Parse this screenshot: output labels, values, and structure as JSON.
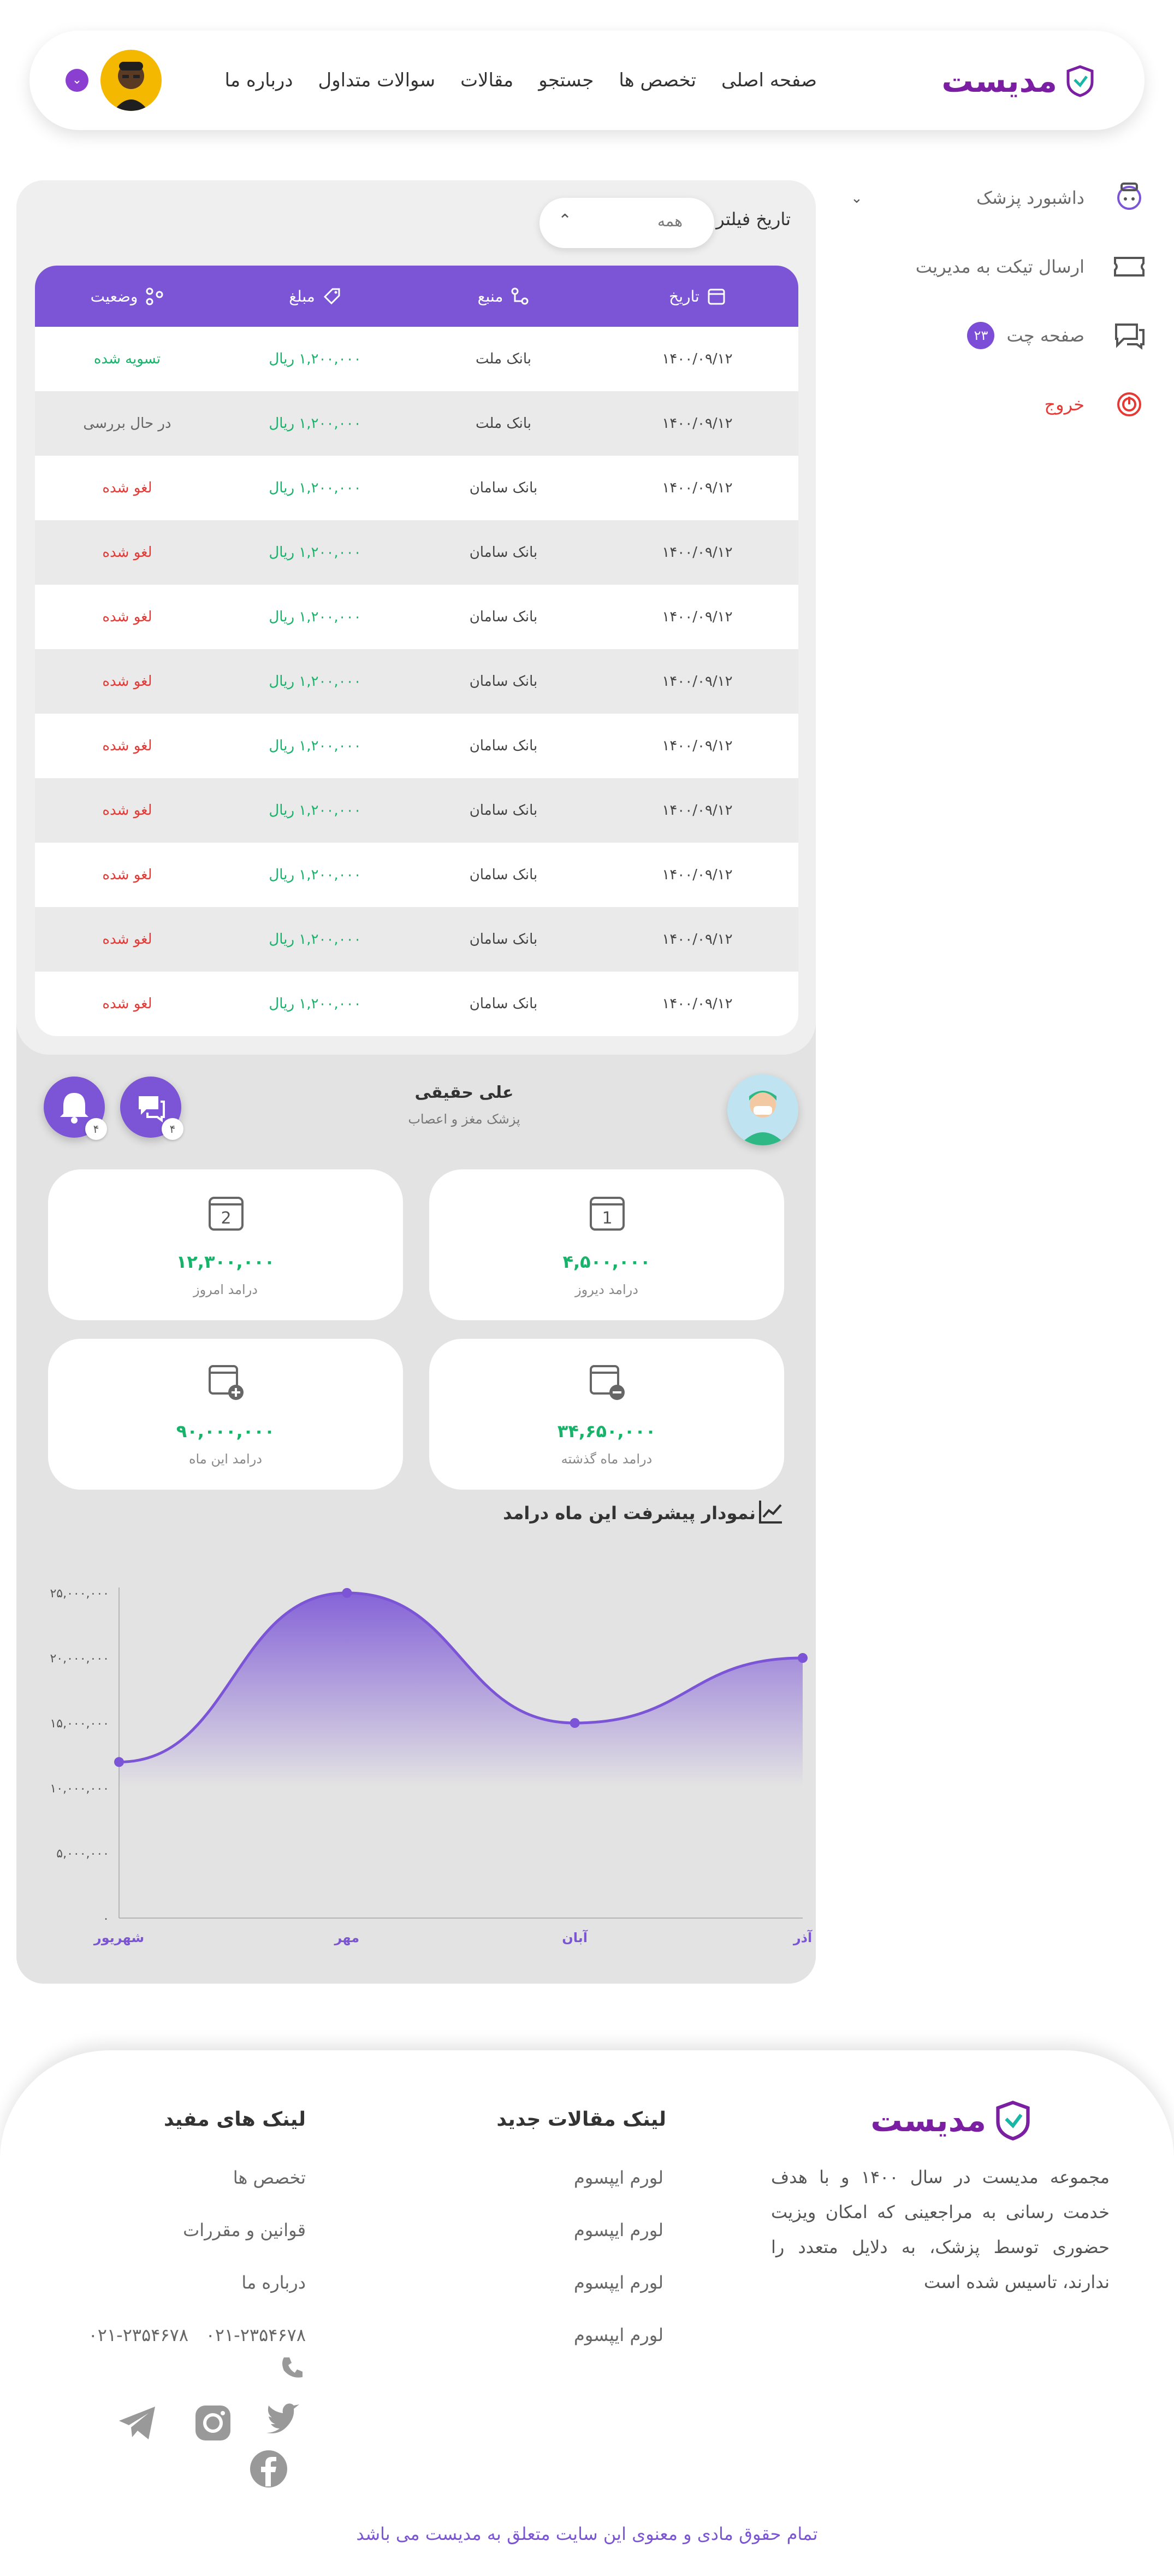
{
  "header": {
    "brand": "مدیست",
    "nav": [
      "صفحه اصلی",
      "تخصص ها",
      "جستجو",
      "مقالات",
      "سوالات متداول",
      "درباره ما"
    ]
  },
  "sidebar": {
    "items": [
      {
        "label": "داشبورد پزشک",
        "icon": "doctor-icon"
      },
      {
        "label": "ارسال تیکت به مدیریت",
        "icon": "ticket-icon"
      },
      {
        "label": "صفحه چت",
        "icon": "chat-icon",
        "badge": "۲۳"
      },
      {
        "label": "خروج",
        "icon": "power-icon"
      }
    ]
  },
  "filter": {
    "label": "تاریخ فیلتر",
    "value": "همه"
  },
  "table": {
    "headers": [
      "تاریخ",
      "منبع",
      "مبلغ",
      "وضعیت"
    ],
    "rows": [
      {
        "date": "۱۴۰۰/۰۹/۱۲",
        "source": "بانک ملت",
        "amount": "۱,۲۰۰,۰۰۰ ریال",
        "status": "تسویه شده",
        "status_type": "green"
      },
      {
        "date": "۱۴۰۰/۰۹/۱۲",
        "source": "بانک ملت",
        "amount": "۱,۲۰۰,۰۰۰ ریال",
        "status": "در حال بررسی",
        "status_type": "gray"
      },
      {
        "date": "۱۴۰۰/۰۹/۱۲",
        "source": "بانک سامان",
        "amount": "۱,۲۰۰,۰۰۰ ریال",
        "status": "لغو شده",
        "status_type": "red"
      },
      {
        "date": "۱۴۰۰/۰۹/۱۲",
        "source": "بانک سامان",
        "amount": "۱,۲۰۰,۰۰۰ ریال",
        "status": "لغو شده",
        "status_type": "red"
      },
      {
        "date": "۱۴۰۰/۰۹/۱۲",
        "source": "بانک سامان",
        "amount": "۱,۲۰۰,۰۰۰ ریال",
        "status": "لغو شده",
        "status_type": "red"
      },
      {
        "date": "۱۴۰۰/۰۹/۱۲",
        "source": "بانک سامان",
        "amount": "۱,۲۰۰,۰۰۰ ریال",
        "status": "لغو شده",
        "status_type": "red"
      },
      {
        "date": "۱۴۰۰/۰۹/۱۲",
        "source": "بانک سامان",
        "amount": "۱,۲۰۰,۰۰۰ ریال",
        "status": "لغو شده",
        "status_type": "red"
      },
      {
        "date": "۱۴۰۰/۰۹/۱۲",
        "source": "بانک سامان",
        "amount": "۱,۲۰۰,۰۰۰ ریال",
        "status": "لغو شده",
        "status_type": "red"
      },
      {
        "date": "۱۴۰۰/۰۹/۱۲",
        "source": "بانک سامان",
        "amount": "۱,۲۰۰,۰۰۰ ریال",
        "status": "لغو شده",
        "status_type": "red"
      },
      {
        "date": "۱۴۰۰/۰۹/۱۲",
        "source": "بانک سامان",
        "amount": "۱,۲۰۰,۰۰۰ ریال",
        "status": "لغو شده",
        "status_type": "red"
      },
      {
        "date": "۱۴۰۰/۰۹/۱۲",
        "source": "بانک سامان",
        "amount": "۱,۲۰۰,۰۰۰ ریال",
        "status": "لغو شده",
        "status_type": "red"
      }
    ]
  },
  "doctor": {
    "name": "علی حقیقی",
    "specialty": "پزشک مغز و اعصاب",
    "chat_badge": "۴",
    "bell_badge": "۴"
  },
  "stats": [
    {
      "value": "۴,۵۰۰,۰۰۰",
      "label": "درامد دیروز"
    },
    {
      "value": "۱۲,۳۰۰,۰۰۰",
      "label": "درامد امروز"
    },
    {
      "value": "۳۴,۶۵۰,۰۰۰",
      "label": "درامد ماه گذشته"
    },
    {
      "value": "۹۰,۰۰۰,۰۰۰",
      "label": "درامد این ماه"
    }
  ],
  "chart_title": "نمودار پیشرفت این ماه درامد",
  "chart_data": {
    "type": "area",
    "categories": [
      "شهریور",
      "مهر",
      "آبان",
      "آذر"
    ],
    "values": [
      12000000,
      25000000,
      15000000,
      20000000
    ],
    "ylim": [
      0,
      25000000
    ],
    "yticks": [
      "۰",
      "۵,۰۰۰,۰۰۰",
      "۱۰,۰۰۰,۰۰۰",
      "۱۵,۰۰۰,۰۰۰",
      "۲۰,۰۰۰,۰۰۰",
      "۲۵,۰۰۰,۰۰۰"
    ],
    "title": "نمودار پیشرفت این ماه درامد",
    "color": "#7b55d6"
  },
  "footer": {
    "brand": "مدیست",
    "about": "مجموعه مدیست در سال ۱۴۰۰ و با هدف خدمت رسانی به مراجعینی که امکان ویزیت حضوری توسط پزشک، به دلایل متعدد را ندارند، تاسیس شده است",
    "articles_title": "لینک مقالات جدید",
    "articles": [
      "لورم ایپسوم",
      "لورم ایپسوم",
      "لورم ایپسوم",
      "لورم ایپسوم"
    ],
    "useful_title": "لینک های مفید",
    "useful": [
      "تخصص ها",
      "قوانین و مقررات",
      "درباره ما"
    ],
    "phones": [
      "۰۲۱-۲۳۵۴۶۷۸",
      "۰۲۱-۲۳۵۴۶۷۸"
    ],
    "copyright": "تمام حقوق مادی و معنوی این سایت متعلق به مدیست می باشد"
  }
}
